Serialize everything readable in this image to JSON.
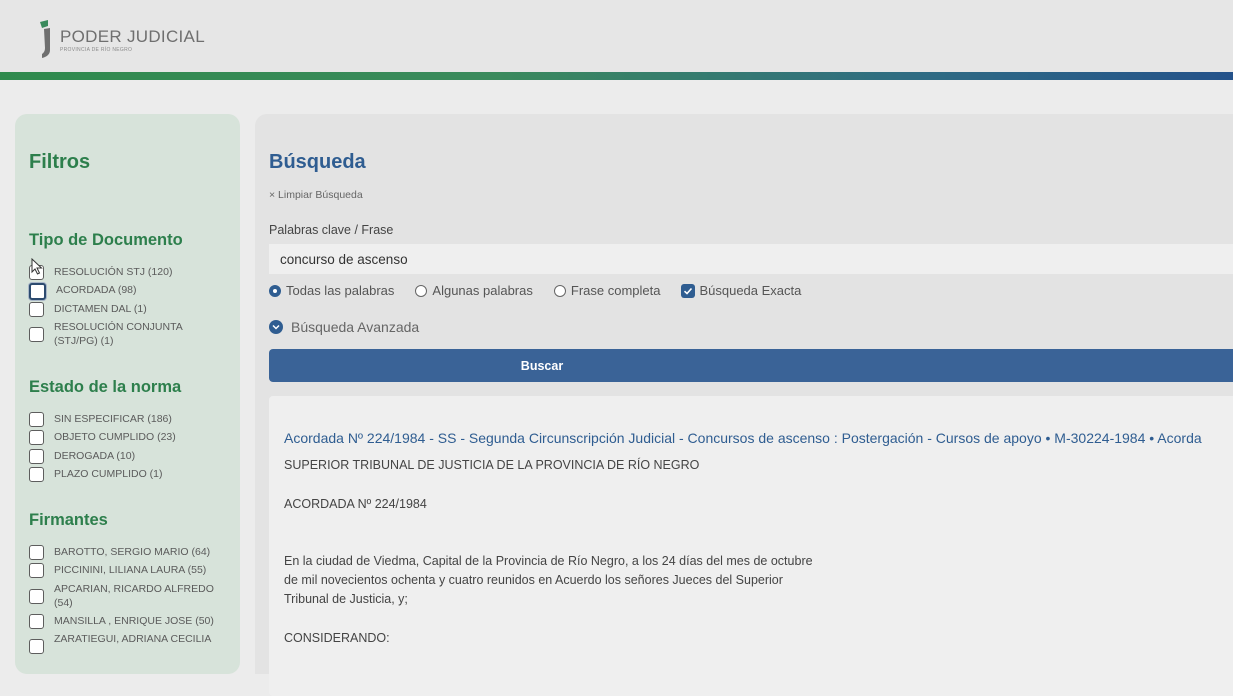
{
  "header": {
    "logo_title": "PODER JUDICIAL",
    "logo_subtitle": "PROVINCIA DE RÍO NEGRO"
  },
  "sidebar": {
    "title": "Filtros",
    "sections": [
      {
        "title": "Tipo de Documento",
        "options": [
          "RESOLUCIÓN STJ (120)",
          "ACORDADA (98)",
          "DICTAMEN DAL (1)",
          "RESOLUCIÓN CONJUNTA (STJ/PG) (1)"
        ]
      },
      {
        "title": "Estado de la norma",
        "options": [
          "SIN ESPECIFICAR (186)",
          "OBJETO CUMPLIDO (23)",
          "DEROGADA (10)",
          "PLAZO CUMPLIDO (1)"
        ]
      },
      {
        "title": "Firmantes",
        "options": [
          "BAROTTO, SERGIO MARIO (64)",
          "PICCININI, LILIANA LAURA (55)",
          "APCARIAN, RICARDO ALFREDO (54)",
          "MANSILLA , ENRIQUE JOSE (50)",
          "ZARATIEGUI, ADRIANA CECILIA"
        ]
      }
    ]
  },
  "search": {
    "title": "Búsqueda",
    "clear_label": "× Limpiar Búsqueda",
    "keyword_label": "Palabras clave / Frase",
    "keyword_value": "concurso de ascenso",
    "radio_options": [
      "Todas las palabras",
      "Algunas palabras",
      "Frase completa"
    ],
    "selected_radio": "Todas las palabras",
    "exact_label": "Búsqueda Exacta",
    "exact_checked": true,
    "advanced_label": "Búsqueda Avanzada",
    "submit_label": "Buscar"
  },
  "result": {
    "title": "Acordada Nº 224/1984 - SS - Segunda Circunscripción Judicial - Concursos de ascenso : Postergación - Cursos de apoyo • M-30224-1984 • Acorda",
    "lines": [
      "SUPERIOR TRIBUNAL DE JUSTICIA DE LA PROVINCIA DE RÍO NEGRO",
      "ACORDADA Nº 224/1984",
      "En la ciudad de Viedma, Capital de la Provincia de Río Negro, a los 24 días del mes de octubre",
      "de mil novecientos ochenta y cuatro reunidos en Acuerdo los señores Jueces del Superior",
      "Tribunal de Justicia, y;",
      "CONSIDERANDO:"
    ]
  },
  "colors": {
    "green_accent": "#2d7f4c",
    "blue_accent": "#2f5d91",
    "button": "#3a6397"
  }
}
